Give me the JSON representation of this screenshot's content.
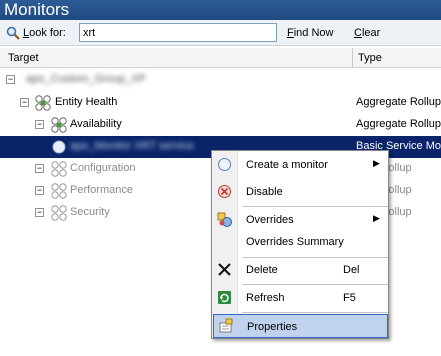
{
  "window": {
    "title": "Monitors"
  },
  "toolbar": {
    "look_for_label": "Look for:",
    "look_for_accel": "L",
    "search_value": "xrt",
    "find_now": "Find Now",
    "find_now_accel": "F",
    "clear": "Clear",
    "clear_accel": "C"
  },
  "columns": {
    "target": "Target",
    "type": "Type"
  },
  "tree": {
    "root": {
      "label": "apo_Custom_Group_XP",
      "type": ""
    },
    "entity_health": {
      "label": "Entity Health",
      "type": "Aggregate Rollup"
    },
    "availability": {
      "label": "Availability",
      "type": "Aggregate Rollup"
    },
    "selected_monitor": {
      "label": "apo_Monitor XRT service",
      "type": "Basic Service Mon"
    },
    "configuration": {
      "label": "Configuration",
      "type": "gate Rollup"
    },
    "performance": {
      "label": "Performance",
      "type": "gate Rollup"
    },
    "security": {
      "label": "Security",
      "type": "gate Rollup"
    }
  },
  "context_menu": {
    "items": [
      {
        "label": "Create a monitor",
        "shortcut": "",
        "submenu": true
      },
      {
        "label": "Disable",
        "shortcut": "",
        "submenu": false
      },
      {
        "label": "Overrides",
        "shortcut": "",
        "submenu": true
      },
      {
        "label": "Overrides Summary",
        "shortcut": "",
        "submenu": false
      },
      {
        "label": "Delete",
        "shortcut": "Del",
        "submenu": false
      },
      {
        "label": "Refresh",
        "shortcut": "F5",
        "submenu": false
      },
      {
        "label": "Properties",
        "shortcut": "",
        "submenu": false
      }
    ],
    "highlighted": "Properties"
  },
  "colors": {
    "title_bar": "#1e4a82",
    "selection": "#0a246a",
    "menu_highlight": "#c1d2ee",
    "menu_highlight_border": "#316ac5"
  },
  "icons": {
    "search": "magnifier-icon",
    "health": "health-state-icon",
    "monitor": "unit-monitor-icon",
    "create": "create-monitor-icon",
    "disable": "disable-icon",
    "overrides": "overrides-icon",
    "delete": "delete-icon",
    "refresh": "refresh-icon",
    "properties": "properties-icon"
  }
}
